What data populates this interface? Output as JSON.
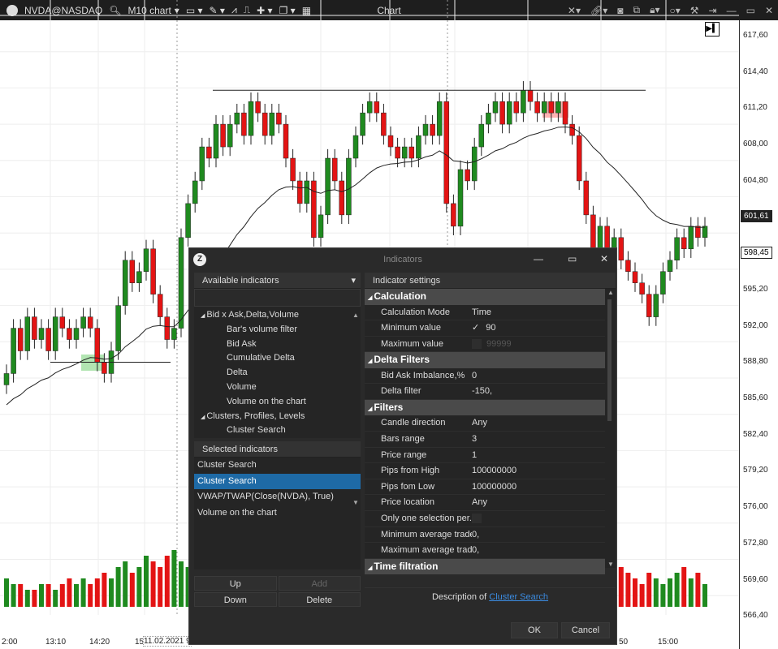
{
  "toolbar": {
    "symbol": "NVDA@NASDAQ",
    "chart_type": "M10 chart",
    "title": "Chart",
    "left_icons": [
      "search-icon",
      "template-icon",
      "pencil-icon",
      "indicator-icon",
      "script-icon",
      "crosshair-icon",
      "window-icon",
      "panel-icon"
    ],
    "right_icons": [
      "cross-icon",
      "link-icon",
      "camera-icon",
      "copy-icon",
      "lock-icon",
      "circle-icon",
      "tools-icon",
      "pin-icon",
      "minimize-icon",
      "maximize-icon",
      "close-icon"
    ]
  },
  "chart": {
    "price_ticks": [
      "617,60",
      "614,40",
      "611,20",
      "608,00",
      "604,80",
      "601,60",
      "598,40",
      "595,20",
      "592,00",
      "588,80",
      "585,60",
      "582,40",
      "579,20",
      "576,00",
      "572,80",
      "569,60",
      "566,40"
    ],
    "price_badges": [
      {
        "label": "601,61",
        "style": "dark"
      },
      {
        "label": "598,45",
        "style": "light"
      }
    ],
    "time_labels": [
      "2:00",
      "13:10",
      "14:20",
      "15",
      "11.02.2021 9",
      "50",
      "15:00"
    ],
    "closes": [
      586,
      590,
      588,
      591,
      589,
      590,
      588,
      591,
      590,
      589,
      590,
      591,
      590,
      587,
      586,
      588,
      592,
      596,
      594,
      595,
      597,
      593,
      591,
      589,
      590,
      598,
      601,
      603,
      606,
      605,
      608,
      606,
      608,
      609,
      607,
      610,
      609,
      607,
      609,
      608,
      605,
      603,
      601,
      603,
      598,
      600,
      605,
      603,
      600,
      605,
      607,
      609,
      610,
      609,
      607,
      606,
      605,
      606,
      605,
      607,
      608,
      607,
      610,
      601,
      599,
      604,
      603,
      606,
      608,
      609,
      610,
      608,
      610,
      609,
      611,
      610,
      609,
      610,
      609,
      610,
      608,
      607,
      603,
      600,
      597,
      599,
      596,
      598,
      596,
      595,
      594,
      593,
      591,
      593,
      595,
      596,
      598,
      597,
      599,
      598,
      599
    ],
    "volumes": [
      5,
      4,
      4,
      3,
      3,
      4,
      4,
      3,
      4,
      5,
      4,
      5,
      4,
      5,
      6,
      5,
      7,
      8,
      6,
      7,
      9,
      8,
      7,
      9,
      10,
      8,
      7,
      9,
      8,
      6,
      7,
      8,
      6,
      5,
      7,
      6,
      8,
      7,
      6,
      5,
      7,
      8,
      6,
      7,
      9,
      8,
      7,
      6,
      5,
      7,
      6,
      8,
      7,
      6,
      5,
      6,
      7,
      5,
      6,
      8,
      7,
      9,
      8,
      7,
      6,
      5,
      7,
      6,
      5,
      6,
      7,
      5,
      6,
      4,
      5,
      6,
      7,
      5,
      6,
      5,
      6,
      8,
      7,
      9,
      8,
      7,
      6,
      5,
      7,
      6,
      5,
      4,
      6,
      5,
      4,
      5,
      6,
      7,
      5,
      6,
      4
    ],
    "colors": {
      "up": "#1f8a1f",
      "down": "#e31414",
      "vwap": "#222222"
    }
  },
  "dialog": {
    "title": "Indicators",
    "available_header": "Available indicators",
    "tree": [
      {
        "label": "Bid x Ask,Delta,Volume",
        "group": true
      },
      {
        "label": "Bar's volume filter"
      },
      {
        "label": "Bid Ask"
      },
      {
        "label": "Cumulative Delta"
      },
      {
        "label": "Delta"
      },
      {
        "label": "Volume"
      },
      {
        "label": "Volume on the chart"
      },
      {
        "label": "Clusters, Profiles, Levels",
        "group": true
      },
      {
        "label": "Cluster Search"
      }
    ],
    "selected_header": "Selected indicators",
    "selected": [
      "Cluster Search",
      "Cluster Search",
      "VWAP/TWAP(Close(NVDA), True)",
      "Volume on the chart"
    ],
    "buttons": {
      "up": "Up",
      "add": "Add",
      "down": "Down",
      "delete": "Delete"
    },
    "settings_header": "Indicator settings",
    "sections": [
      {
        "title": "Calculation",
        "rows": [
          [
            "Calculation Mode",
            "Time"
          ],
          [
            "Minimum value",
            "90"
          ],
          [
            "Maximum value",
            "99999"
          ]
        ]
      },
      {
        "title": "Delta Filters",
        "rows": [
          [
            "Bid Ask Imbalance,%",
            "0"
          ],
          [
            "Delta filter",
            "-150,"
          ]
        ]
      },
      {
        "title": "Filters",
        "rows": [
          [
            "Candle direction",
            "Any"
          ],
          [
            "Bars range",
            "3"
          ],
          [
            "Price range",
            "1"
          ],
          [
            "Pips from High",
            "100000000"
          ],
          [
            "Pips fom Low",
            "100000000"
          ],
          [
            "Price location",
            "Any"
          ],
          [
            "Only one selection per...",
            ""
          ],
          [
            "Minimum average trade",
            "0,"
          ],
          [
            "Maximum average trade",
            "0,"
          ]
        ]
      },
      {
        "title": "Time filtration",
        "rows": []
      }
    ],
    "description_prefix": "Description of",
    "description_link": "Cluster Search",
    "ok": "OK",
    "cancel": "Cancel"
  }
}
